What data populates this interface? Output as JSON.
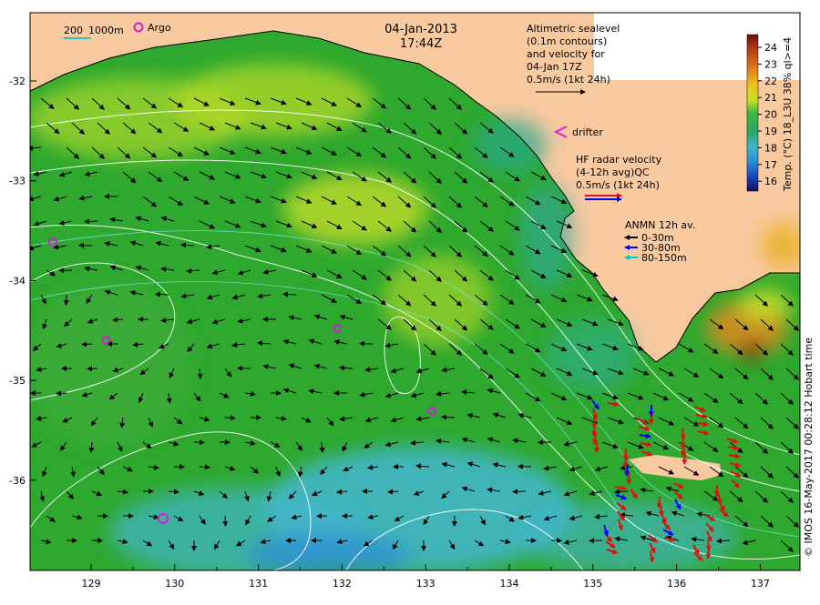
{
  "header": {
    "date": "04-Jan-2013",
    "time": "17:44Z"
  },
  "scale_bar": {
    "label_200": "200",
    "label_1000": "1000m"
  },
  "argo_label": "Argo",
  "altimetric_note": [
    "Altimetric sealevel",
    "(0.1m contours)",
    "and velocity for",
    "04-Jan 17Z",
    "0.5m/s (1kt 24h)"
  ],
  "drifter_label": "drifter",
  "hf_radar_note": [
    "HF radar velocity",
    "(4-12h avg)QC",
    "0.5m/s (1kt 24h)"
  ],
  "anmn_legend": {
    "title": "ANMN 12h av.",
    "items": [
      {
        "label": "0-30m",
        "color": "#000000"
      },
      {
        "label": "30-80m",
        "color": "#0000ff"
      },
      {
        "label": "80-150m",
        "color": "#00c8c8"
      }
    ]
  },
  "colorbar": {
    "title": "Temp. (°C) 18_L3U 38% ql>=4",
    "ticks": [
      "24",
      "23",
      "22",
      "21",
      "20",
      "19",
      "18",
      "17",
      "16"
    ]
  },
  "axes": {
    "x_ticks": [
      "129",
      "130",
      "131",
      "132",
      "133",
      "134",
      "135",
      "136",
      "137"
    ],
    "y_ticks": [
      "-32",
      "-33",
      "-34",
      "-35",
      "-36"
    ]
  },
  "credit": "© IMOS 16-May-2017 00:28:12 Hobart time",
  "colors": {
    "land": "#f9c9a0",
    "sea_green": "#2ea82e",
    "sea_yellow": "#d6e22a",
    "sea_cyan": "#43b6cf",
    "sea_blue": "#2c8bd6",
    "hf_radar": "#e01010",
    "argo": "#d020d0"
  }
}
